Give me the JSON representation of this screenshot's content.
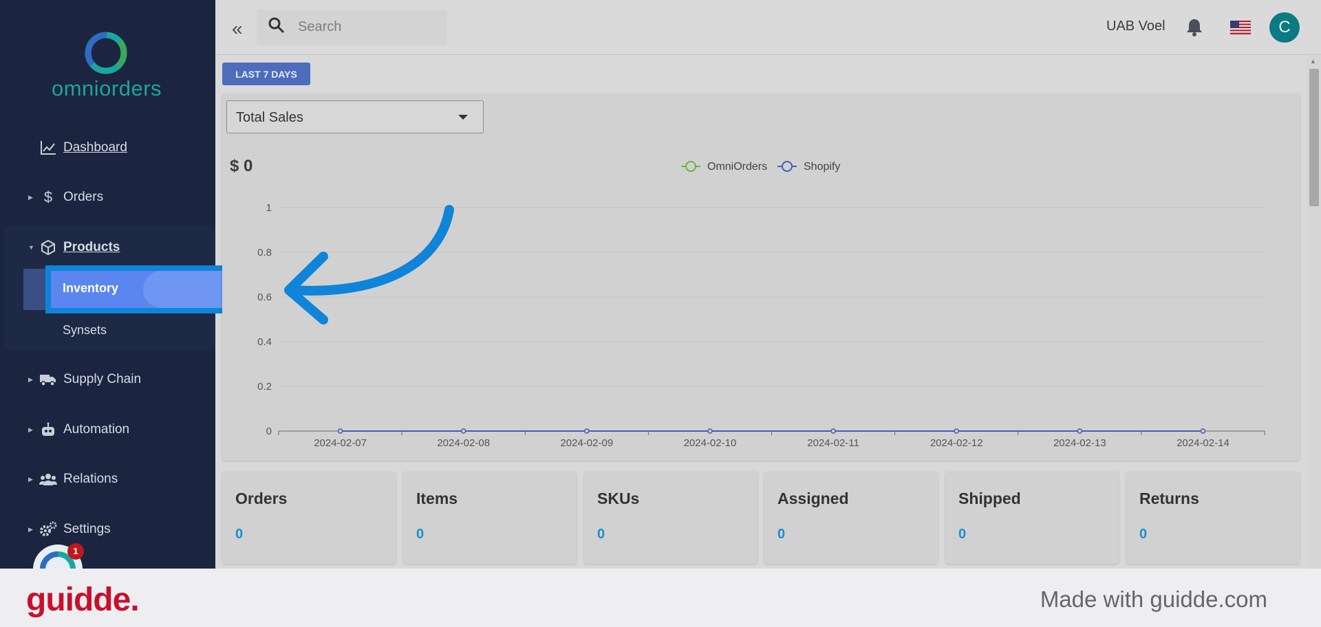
{
  "sidebar": {
    "logo_text": "omniorders",
    "nav": {
      "dashboard": "Dashboard",
      "orders": "Orders",
      "products": "Products",
      "inventory": "Inventory",
      "synsets": "Synsets",
      "supply_chain": "Supply Chain",
      "automation": "Automation",
      "relations": "Relations",
      "settings": "Settings"
    },
    "help_badge": "1"
  },
  "header": {
    "search_placeholder": "Search",
    "company": "UAB Voel",
    "avatar_initial": "C"
  },
  "main": {
    "range_button": "LAST 7 DAYS",
    "metric_select": "Total Sales",
    "total_value": "$ 0",
    "stats": [
      {
        "title": "Orders",
        "value": "0"
      },
      {
        "title": "Items",
        "value": "0"
      },
      {
        "title": "SKUs",
        "value": "0"
      },
      {
        "title": "Assigned",
        "value": "0"
      },
      {
        "title": "Shipped",
        "value": "0"
      },
      {
        "title": "Returns",
        "value": "0"
      }
    ]
  },
  "chart_data": {
    "type": "line",
    "x": [
      "2024-02-07",
      "2024-02-08",
      "2024-02-09",
      "2024-02-10",
      "2024-02-11",
      "2024-02-12",
      "2024-02-13",
      "2024-02-14"
    ],
    "series": [
      {
        "name": "OmniOrders",
        "values": [
          0,
          0,
          0,
          0,
          0,
          0,
          0,
          0
        ],
        "color": "#6bb04a"
      },
      {
        "name": "Shopify",
        "values": [
          0,
          0,
          0,
          0,
          0,
          0,
          0,
          0
        ],
        "color": "#3f5fb3"
      }
    ],
    "yticks": [
      "0",
      "0.2",
      "0.4",
      "0.6",
      "0.8",
      "1"
    ],
    "ylim": [
      0,
      1
    ],
    "grid": true,
    "legend": "top-center"
  },
  "footer": {
    "brand": "guidde.",
    "made_with": "Made with guidde.com"
  },
  "colors": {
    "sidebar_bg": "#1b2540",
    "accent": "#5b86ef",
    "annotation": "#0f84d8",
    "brand_red": "#c8102e"
  }
}
